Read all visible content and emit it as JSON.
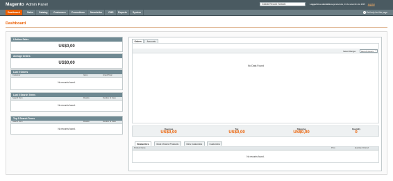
{
  "header": {
    "logo_brand": "Magento",
    "logo_sub": "Admin Panel",
    "search_value": "Global Record Search",
    "logged_in_text": "Logged in as devmidia",
    "date_text": "segunda-feira, 14 de setembro de 2015",
    "logout_label": "Log Out"
  },
  "nav": {
    "items": [
      "Dashboard",
      "Sales",
      "Catalog",
      "Customers",
      "Promotions",
      "Newsletter",
      "CMS",
      "Reports",
      "System"
    ],
    "help_label": "Get help for this page"
  },
  "page": {
    "title": "Dashboard"
  },
  "left": {
    "lifetime_sales": {
      "title": "Lifetime Sales",
      "value": "US$0,00"
    },
    "average_orders": {
      "title": "Average Orders",
      "value": "US$0,00"
    },
    "last_orders": {
      "title": "Last 5 Orders",
      "columns": [
        "Customer",
        "Items",
        "Grand Total"
      ],
      "empty": "No records found."
    },
    "last_search": {
      "title": "Last 5 Search Terms",
      "columns": [
        "Search Term",
        "Results",
        "Number of Uses"
      ],
      "empty": "No records found."
    },
    "top_search": {
      "title": "Top 5 Search Terms",
      "columns": [
        "Search Term",
        "Results",
        "Number of Uses"
      ],
      "empty": "No records found."
    }
  },
  "right": {
    "tabs": [
      "Orders",
      "Amounts"
    ],
    "range_label": "Select Range:",
    "range_value": "Last 24 Hours",
    "no_data": "No Data Found",
    "totals": [
      {
        "label": "Revenue",
        "value": "US$0,00"
      },
      {
        "label": "Tax",
        "value": "US$0,00"
      },
      {
        "label": "Shipping",
        "value": "US$0,00"
      },
      {
        "label": "Quantity",
        "value": "0"
      }
    ],
    "bottom_tabs": [
      "Bestsellers",
      "Most Viewed Products",
      "New Customers",
      "Customers"
    ],
    "columns": [
      "Product Name",
      "Price",
      "Quantity Ordered"
    ],
    "empty": "No records found."
  },
  "colors": {
    "accent": "#eb5e00",
    "header": "#4a5a61",
    "nav": "#6b7d84",
    "box_head": "#6f8992"
  }
}
